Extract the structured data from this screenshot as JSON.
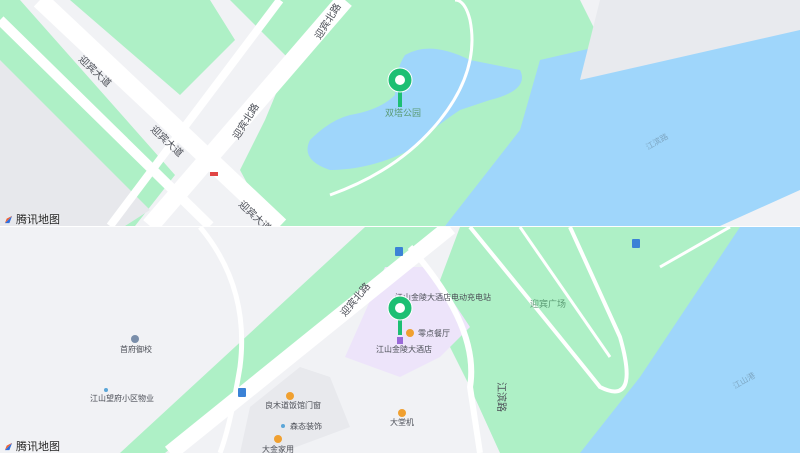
{
  "brand": {
    "logo_text": "腾讯地图",
    "accent": "#1dbf73",
    "water": "#9fd6fb",
    "park": "#aef0c6"
  },
  "top_map": {
    "roads": [
      "迎宾大道",
      "迎宾大道",
      "迎宾大道",
      "迎宾北路",
      "迎宾北路",
      "江滨路"
    ],
    "poi": "双塔公园"
  },
  "bottom_map": {
    "roads": [
      "迎宾北路",
      "江滨路"
    ],
    "pois": [
      "江山金陵大酒店电动充电站",
      "零点餐厅",
      "江山金陵大酒店",
      "首府御校",
      "江山望府小区物业",
      "良木道饭馆门窗",
      "森态装饰",
      "大金家用",
      "大堂机",
      "迎宾广场"
    ],
    "water_label": "江山港"
  }
}
